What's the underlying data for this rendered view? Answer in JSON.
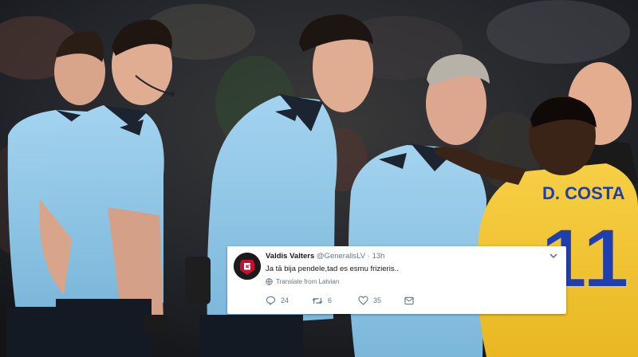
{
  "tweet": {
    "name": "Valdis Valters",
    "handle": "@GeneralisLV",
    "time": "13h",
    "text": "Ja tā bija pendele,tad es esmu frizieris..",
    "translate_label": "Translate from Latvian",
    "reply_count": "24",
    "retweet_count": "6",
    "like_count": "35"
  },
  "jersey": {
    "name": "D. COSTA",
    "number": "11"
  },
  "colors": {
    "referee_shirt": "#8ec6e6",
    "referee_collar": "#1c2431",
    "juventus_yellow": "#f4c430",
    "juventus_blue": "#1f3fb0",
    "tweet_text": "#14171a",
    "tweet_meta": "#657786"
  },
  "icons": {
    "avatar": "avatar-logo-icon",
    "caret": "chevron-down-icon",
    "globe": "globe-icon",
    "reply": "reply-icon",
    "retweet": "retweet-icon",
    "like": "heart-icon",
    "message": "direct-message-icon"
  }
}
